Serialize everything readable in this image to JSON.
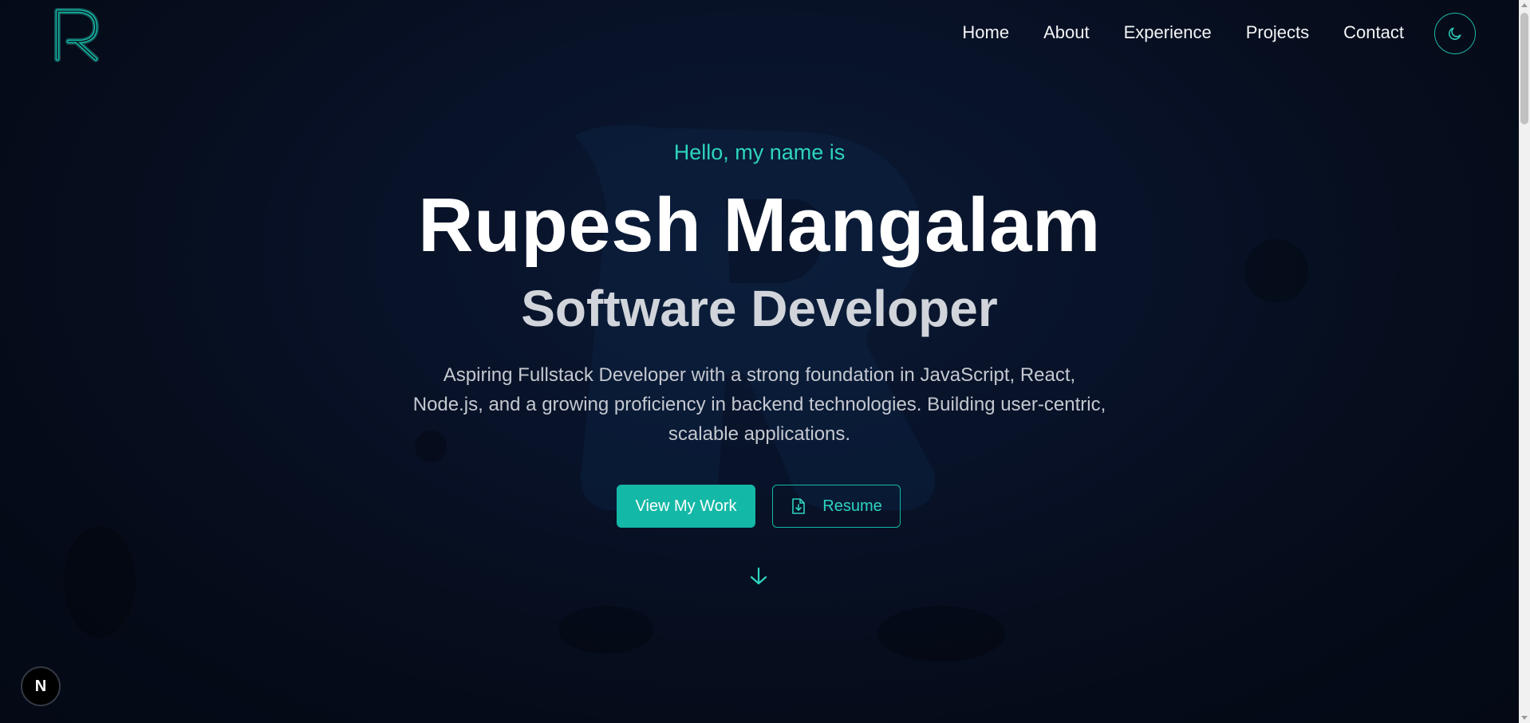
{
  "logo": {
    "letter": "R"
  },
  "nav": {
    "items": [
      {
        "label": "Home"
      },
      {
        "label": "About"
      },
      {
        "label": "Experience"
      },
      {
        "label": "Projects"
      },
      {
        "label": "Contact"
      }
    ],
    "theme_icon": "moon-icon"
  },
  "hero": {
    "greeting": "Hello, my name is",
    "name": "Rupesh Mangalam",
    "role": "Software Developer",
    "description": "Aspiring Fullstack Developer with a strong foundation in JavaScript, React, Node.js, and a growing proficiency in backend technologies. Building user-centric, scalable applications.",
    "primary_button": "View My Work",
    "secondary_button": "Resume",
    "secondary_button_icon": "file-download-icon",
    "scroll_icon": "arrow-down-icon"
  },
  "dev_badge": {
    "letter": "N"
  },
  "colors": {
    "accent": "#14b8a6",
    "accent_text": "#2dd4bf",
    "background": "#050b18"
  }
}
